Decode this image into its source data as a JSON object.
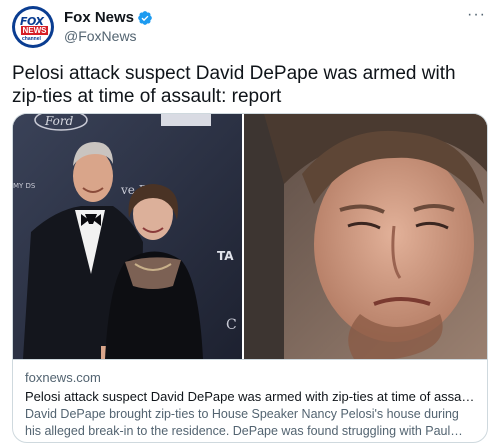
{
  "account": {
    "display_name": "Fox News",
    "handle": "@FoxNews",
    "avatar_text_top": "FOX",
    "avatar_text_mid": "NEWS",
    "avatar_text_bottom": "channel",
    "verified": true
  },
  "more_label": "···",
  "tweet": {
    "text": "Pelosi attack suspect David DePape was armed with zip-ties at time of assault: report"
  },
  "card": {
    "domain": "foxnews.com",
    "title": "Pelosi attack suspect David DePape was armed with zip-ties at time of assault:...",
    "description": "David DePape brought zip-ties to House Speaker Nancy Pelosi's house during his alleged break-in to the residence. DePape was found struggling with Paul Pelos...",
    "photo_left_backdrop_text": "Ford",
    "photo_left_backdrop_side": "MY DS",
    "photo_left_backdrop_ta": "TA"
  },
  "colors": {
    "verified_blue": "#1d9bf0",
    "fox_blue": "#0a3d91",
    "fox_red": "#d61f26"
  },
  "icons": {
    "verified": "verified-badge-icon",
    "more": "more-options-icon"
  }
}
